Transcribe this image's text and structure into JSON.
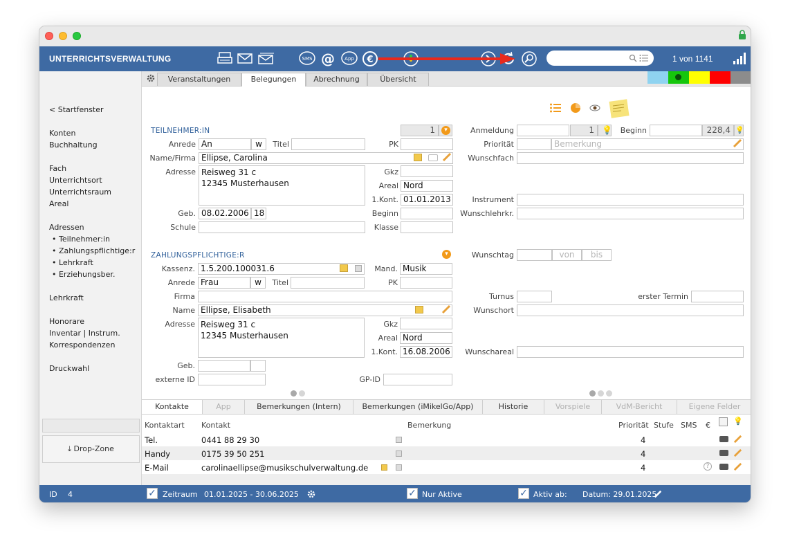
{
  "app": {
    "title": "UNTERRICHTSVERWALTUNG",
    "record_nav": "1 von 1141",
    "search_placeholder": ""
  },
  "sidebar": {
    "back": "< Startfenster",
    "items": [
      {
        "label": "Konten"
      },
      {
        "label": "Buchhaltung"
      },
      {
        "label": "Fach"
      },
      {
        "label": "Unterrichtsort"
      },
      {
        "label": "Unterrichtsraum"
      },
      {
        "label": "Areal"
      },
      {
        "label": "Adressen"
      },
      {
        "label": "• Teilnehmer:in"
      },
      {
        "label": "• Zahlungspflichtige:r"
      },
      {
        "label": "• Lehrkraft"
      },
      {
        "label": "• Erziehungsber."
      },
      {
        "label": "Lehrkraft"
      },
      {
        "label": "Honorare"
      },
      {
        "label": "Inventar | Instrum."
      },
      {
        "label": "Korrespondenzen"
      },
      {
        "label": "Druckwahl"
      }
    ],
    "dropzone": "Drop-Zone"
  },
  "top_tabs": [
    {
      "label": "Veranstaltungen"
    },
    {
      "label": "Belegungen"
    },
    {
      "label": "Abrechnung"
    },
    {
      "label": "Übersicht"
    }
  ],
  "colors": {
    "accent": "#3e6aa3",
    "cyan": "#8fd3f0",
    "green": "#16c60c",
    "yellow": "#ffff00",
    "red": "#ff0000",
    "gray": "#8c8c8c"
  },
  "teilnehmer": {
    "title": "TEILNEHMER:IN",
    "counter": "1",
    "labels": {
      "anrede": "Anrede",
      "titel": "Titel",
      "pk": "PK",
      "name": "Name/Firma",
      "adresse": "Adresse",
      "gkz": "Gkz",
      "areal": "Areal",
      "kont": "1.Kont.",
      "geb": "Geb.",
      "beginn": "Beginn",
      "schule": "Schule",
      "klasse": "Klasse"
    },
    "anrede": "An",
    "gender": "w",
    "titel": "",
    "pk": "",
    "name": "Ellipse, Carolina",
    "adresse": "Reisweg 31 c\n12345 Musterhausen",
    "gkz": "",
    "areal": "Nord",
    "kont": "01.01.2013",
    "geb": "08.02.2006",
    "age": "18",
    "beginn": "",
    "schule": "",
    "klasse": ""
  },
  "anmeldung": {
    "labels": {
      "anmeldung": "Anmeldung",
      "beginn": "Beginn",
      "prioritaet": "Priorität",
      "wunschfach": "Wunschfach",
      "instrument": "Instrument",
      "wunschlehrkr": "Wunschlehrkr.",
      "wunschtag": "Wunschtag",
      "turnus": "Turnus",
      "erster_termin": "erster Termin",
      "wunschort": "Wunschort",
      "wunschareal": "Wunschareal"
    },
    "counter": "1",
    "beginn_value": "228,4",
    "bemerkung_placeholder": "Bemerkung",
    "von": "von",
    "bis": "bis"
  },
  "zahlung": {
    "title": "ZAHLUNGSPFLICHTIGE:R",
    "labels": {
      "kassenz": "Kassenz.",
      "mand": "Mand.",
      "anrede": "Anrede",
      "titel": "Titel",
      "pk": "PK",
      "firma": "Firma",
      "name": "Name",
      "adresse": "Adresse",
      "gkz": "Gkz",
      "areal": "Areal",
      "kont": "1.Kont.",
      "geb": "Geb.",
      "externe_id": "externe ID",
      "gp_id": "GP-ID"
    },
    "kassenz": "1.5.200.100031.6",
    "mand": "Musik",
    "anrede": "Frau",
    "gender": "w",
    "name": "Ellipse, Elisabeth",
    "adresse": "Reisweg 31 c\n12345 Musterhausen",
    "areal": "Nord",
    "kont": "16.08.2006"
  },
  "bottom_tabs": [
    {
      "label": "Kontakte"
    },
    {
      "label": "App"
    },
    {
      "label": "Bemerkungen (Intern)"
    },
    {
      "label": "Bemerkungen (iMikelGo/App)"
    },
    {
      "label": "Historie"
    },
    {
      "label": "Vorspiele"
    },
    {
      "label": "VdM-Bericht"
    },
    {
      "label": "Eigene Felder"
    }
  ],
  "contacts": {
    "headers": {
      "kontaktart": "Kontaktart",
      "kontakt": "Kontakt",
      "bemerkung": "Bemerkung",
      "prioritaet": "Priorität",
      "stufe": "Stufe",
      "sms": "SMS",
      "euro": "€"
    },
    "rows": [
      {
        "art": "Tel.",
        "kontakt": "0441 88 29 30",
        "prio": "4"
      },
      {
        "art": "Handy",
        "kontakt": "0175 39 50 251",
        "prio": "4"
      },
      {
        "art": "E-Mail",
        "kontakt": "carolinaellipse@musikschulverwaltung.de",
        "prio": "4"
      }
    ]
  },
  "status": {
    "id_label": "ID",
    "id_value": "4",
    "zeitraum_label": "Zeitraum",
    "zeitraum_value": "01.01.2025  -  30.06.2025",
    "nur_aktive": "Nur Aktive",
    "aktiv_ab": "Aktiv ab:",
    "datum": "Datum: 29.01.2025"
  }
}
